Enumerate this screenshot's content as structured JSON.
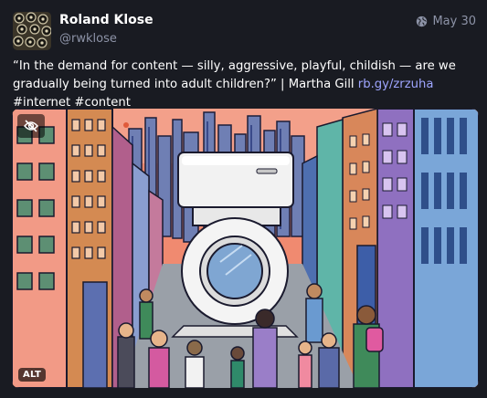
{
  "post": {
    "author": {
      "display_name": "Roland Klose",
      "handle": "@rwklose"
    },
    "visibility_icon": "globe-icon",
    "date": "May 30",
    "content": {
      "quote": "“In the demand for content — silly, aggressive, playful, childish — are we gradually being turned into adult children?” | Martha Gill ",
      "link_text": "rb.gy/zrzuha",
      "hashtags": [
        "#internet",
        "#content"
      ]
    },
    "media": {
      "hide_icon": "eye-slash-icon",
      "alt_badge": "ALT"
    }
  }
}
